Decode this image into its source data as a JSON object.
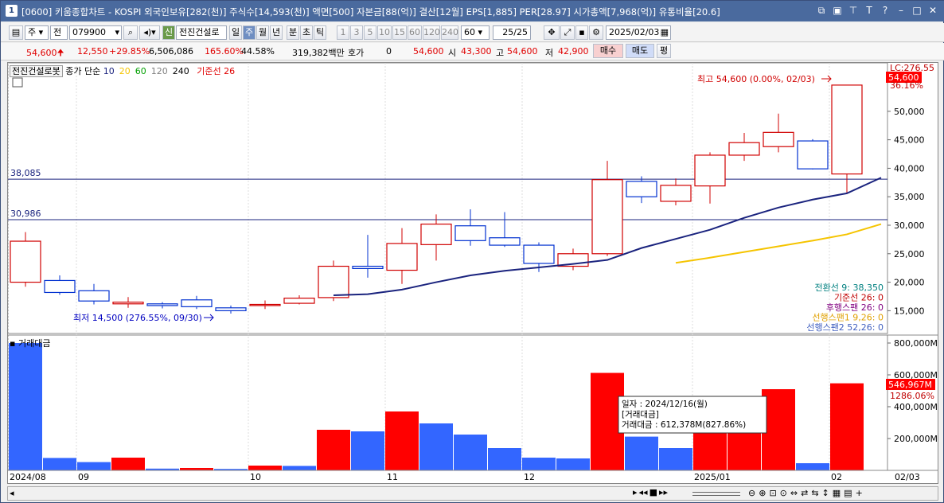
{
  "title": {
    "number": "1",
    "text": "[0600] 키움종합차트 - KOSPI 외국인보유[282(천)] 주식수[14,593(천)] 액면[500] 자본금[88(억)] 결산[12월] EPS[1,885] PER[28.97] 시가총액[7,968(억)] 유통비율[20.6]"
  },
  "toolbar": {
    "type": "주",
    "market": "전",
    "code": "079900",
    "new_badge": "신",
    "stock_name": "전진건설로",
    "periods": [
      "일",
      "주",
      "월",
      "년",
      "분",
      "초",
      "틱"
    ],
    "selected_period": "주",
    "counts": [
      "1",
      "3",
      "5",
      "10",
      "15",
      "60",
      "120",
      "240"
    ],
    "count_value": "60",
    "page": "25/25",
    "date": "2025/02/03"
  },
  "info": {
    "price": "54,600",
    "change": "12,550",
    "change_pct": "+29.85%",
    "volume": "6,506,086",
    "vol_ratio": "165.60%",
    "turnover": "44.58%",
    "amount": "319,382백만",
    "quote_label": "호가",
    "quote_value": "0",
    "quote_price": "54,600",
    "open_label": "시",
    "open": "43,300",
    "high_label": "고",
    "high": "54,600",
    "low_label": "저",
    "low": "42,900",
    "buy": "매수",
    "sell": "매도",
    "avg": "평"
  },
  "legend": {
    "name": "전진건설로봇",
    "price_label": "종가 단순",
    "ma": [
      {
        "label": "10",
        "color": "#1a237e"
      },
      {
        "label": "20",
        "color": "#f5c400"
      },
      {
        "label": "60",
        "color": "#00a000"
      },
      {
        "label": "120",
        "color": "#808080"
      },
      {
        "label": "240",
        "color": "#000000"
      }
    ],
    "base_label": "기준선 26",
    "volume_label": "거래대금"
  },
  "ichimoku": [
    {
      "text": "전환선 9: 38,350",
      "color": "#008080"
    },
    {
      "text": "기준선 26: 0",
      "color": "#c00000"
    },
    {
      "text": "후행스팬 26: 0",
      "color": "#800080"
    },
    {
      "text": "선행스팬1 9,26: 0",
      "color": "#e0a000"
    },
    {
      "text": "선행스팬2 52,26: 0",
      "color": "#4060c0"
    }
  ],
  "annotations": {
    "high": "최고 54,600 (0.00%, 02/03)",
    "low": "최저 14,500 (276.55%, 09/30)",
    "hline1": "38,085",
    "hline2": "30,986",
    "lc": "LC:276.55",
    "last_price": "54,600",
    "last_pct": "36.16%",
    "vol_last": "546,967M",
    "vol_last_pct": "1286.06%"
  },
  "tooltip": {
    "line1": "일자      : 2024/12/16(월)",
    "line2": "[거래대금]",
    "line3": " 거래대금 : 612,378M(827.86%)"
  },
  "chart_data": [
    {
      "type": "candlestick",
      "title": "전진건설로봇",
      "ylim": [
        11000,
        58500
      ],
      "yticks": [
        "15,000",
        "20,000",
        "25,000",
        "30,000",
        "35,000",
        "40,000",
        "45,000",
        "50,000"
      ],
      "xtick_labels": [
        "2024/08",
        "09",
        "10",
        "11",
        "12",
        "2025/01",
        "02",
        "02/03"
      ],
      "candles": [
        {
          "o": 20000,
          "h": 28800,
          "l": 19200,
          "c": 27200
        },
        {
          "o": 20300,
          "h": 21200,
          "l": 17800,
          "c": 18200
        },
        {
          "o": 18500,
          "h": 19700,
          "l": 16100,
          "c": 16700
        },
        {
          "o": 16200,
          "h": 17400,
          "l": 15500,
          "c": 16500
        },
        {
          "o": 16200,
          "h": 16500,
          "l": 15400,
          "c": 15900
        },
        {
          "o": 16900,
          "h": 17600,
          "l": 15300,
          "c": 15700
        },
        {
          "o": 15500,
          "h": 15900,
          "l": 14500,
          "c": 15000
        },
        {
          "o": 15900,
          "h": 16800,
          "l": 15300,
          "c": 16100
        },
        {
          "o": 16300,
          "h": 17700,
          "l": 16100,
          "c": 17200
        },
        {
          "o": 17300,
          "h": 23800,
          "l": 16700,
          "c": 22800
        },
        {
          "o": 22800,
          "h": 28300,
          "l": 20800,
          "c": 22400
        },
        {
          "o": 22100,
          "h": 29500,
          "l": 19700,
          "c": 26800
        },
        {
          "o": 26600,
          "h": 31900,
          "l": 23800,
          "c": 30200
        },
        {
          "o": 29900,
          "h": 32800,
          "l": 26400,
          "c": 27300
        },
        {
          "o": 27800,
          "h": 32300,
          "l": 26200,
          "c": 26500
        },
        {
          "o": 26500,
          "h": 27000,
          "l": 21800,
          "c": 23300
        },
        {
          "o": 22800,
          "h": 25900,
          "l": 22100,
          "c": 25000
        },
        {
          "o": 25000,
          "h": 41300,
          "l": 24600,
          "c": 38000
        },
        {
          "o": 37700,
          "h": 38600,
          "l": 33900,
          "c": 35000
        },
        {
          "o": 34200,
          "h": 38200,
          "l": 33500,
          "c": 37000
        },
        {
          "o": 36900,
          "h": 42800,
          "l": 33800,
          "c": 42300
        },
        {
          "o": 42300,
          "h": 46200,
          "l": 41300,
          "c": 44500
        },
        {
          "o": 43800,
          "h": 49600,
          "l": 42800,
          "c": 46300
        },
        {
          "o": 44800,
          "h": 45100,
          "l": 39800,
          "c": 39900
        },
        {
          "o": 39000,
          "h": 54600,
          "l": 35700,
          "c": 54600
        }
      ],
      "series": [
        {
          "name": "10",
          "color": "#1a237e",
          "start": 9,
          "values": [
            17700,
            17900,
            18700,
            20000,
            21200,
            22000,
            22600,
            23200,
            23900,
            26000,
            27600,
            29200,
            31300,
            33100,
            34500,
            35600,
            38350
          ]
        },
        {
          "name": "20",
          "color": "#f5c400",
          "start": 19,
          "values": [
            23400,
            24300,
            25300,
            26300,
            27300,
            28400,
            30200
          ]
        }
      ],
      "hlines": [
        38085,
        30986
      ]
    },
    {
      "type": "bar",
      "title": "거래대금",
      "ylim": [
        0,
        820000
      ],
      "yticks": [
        "200,000M",
        "400,000M",
        "600,000M",
        "800,000M"
      ],
      "values": [
        800000,
        78000,
        52000,
        80000,
        11000,
        15000,
        9000,
        30000,
        28000,
        255000,
        245000,
        370000,
        295000,
        225000,
        140000,
        80000,
        75000,
        612378,
        212000,
        140000,
        335000,
        335000,
        510000,
        45000,
        546967
      ],
      "colors": [
        "b",
        "b",
        "b",
        "r",
        "b",
        "r",
        "b",
        "r",
        "b",
        "r",
        "b",
        "r",
        "b",
        "b",
        "b",
        "b",
        "b",
        "r",
        "b",
        "b",
        "r",
        "r",
        "r",
        "b",
        "r"
      ]
    }
  ]
}
